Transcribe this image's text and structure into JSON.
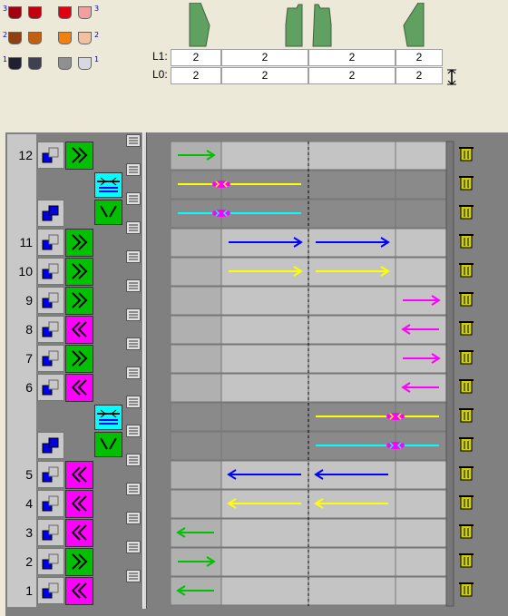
{
  "legend": {
    "labels": [
      "3",
      "2",
      "1",
      "3",
      "2",
      "1"
    ]
  },
  "lanes": {
    "l1_label": "L1:",
    "l0_label": "L0:",
    "l1_values": [
      "2",
      "2",
      "2",
      "2"
    ],
    "l0_values": [
      "2",
      "2",
      "2",
      "2"
    ]
  },
  "rows": [
    {
      "num": "12"
    },
    {
      "num": ""
    },
    {
      "num": ""
    },
    {
      "num": "11"
    },
    {
      "num": "10"
    },
    {
      "num": "9"
    },
    {
      "num": "8"
    },
    {
      "num": "7"
    },
    {
      "num": "6"
    },
    {
      "num": ""
    },
    {
      "num": ""
    },
    {
      "num": "5"
    },
    {
      "num": "4"
    },
    {
      "num": "3"
    },
    {
      "num": "2"
    },
    {
      "num": "1"
    }
  ],
  "colors": {
    "green": "#00c000",
    "magenta": "#ff00ff",
    "blue": "#0000ff",
    "yellow": "#ffff00",
    "cyan": "#00ffff"
  }
}
